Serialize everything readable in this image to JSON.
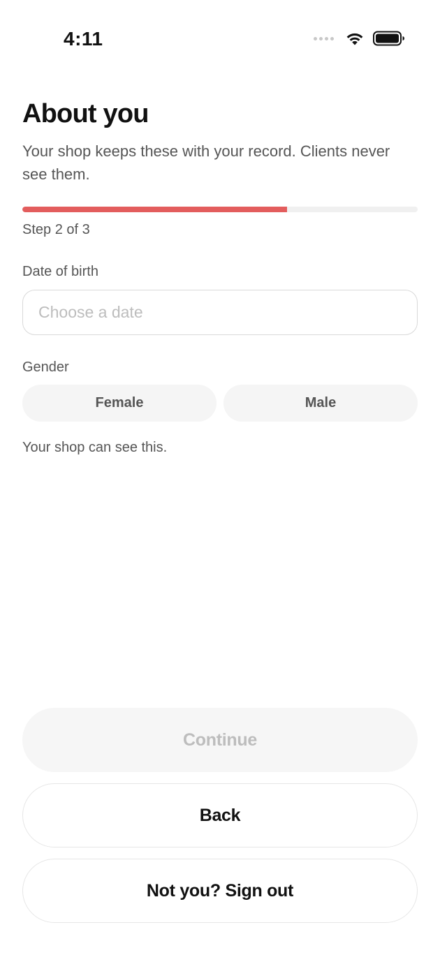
{
  "status_bar": {
    "time": "4:11",
    "icons": [
      "signal-dots-icon",
      "wifi-icon",
      "battery-icon"
    ]
  },
  "header": {
    "title": "About you",
    "subtitle": "Your shop keeps these with your record. Clients never see them."
  },
  "progress": {
    "current_step": 2,
    "total_steps": 3,
    "fraction": 0.67,
    "step_text": "Step 2 of 3",
    "fill_color": "#e35d5d",
    "track_color": "#f0f0f0"
  },
  "form": {
    "dob": {
      "label": "Date of birth",
      "value": "",
      "placeholder": "Choose a date"
    },
    "gender": {
      "label": "Gender",
      "options": [
        "Female",
        "Male"
      ],
      "selected": null
    },
    "privacy_note": "Your shop can see this."
  },
  "actions": {
    "continue_label": "Continue",
    "continue_disabled": true,
    "back_label": "Back",
    "signout_label": "Not you? Sign out"
  }
}
